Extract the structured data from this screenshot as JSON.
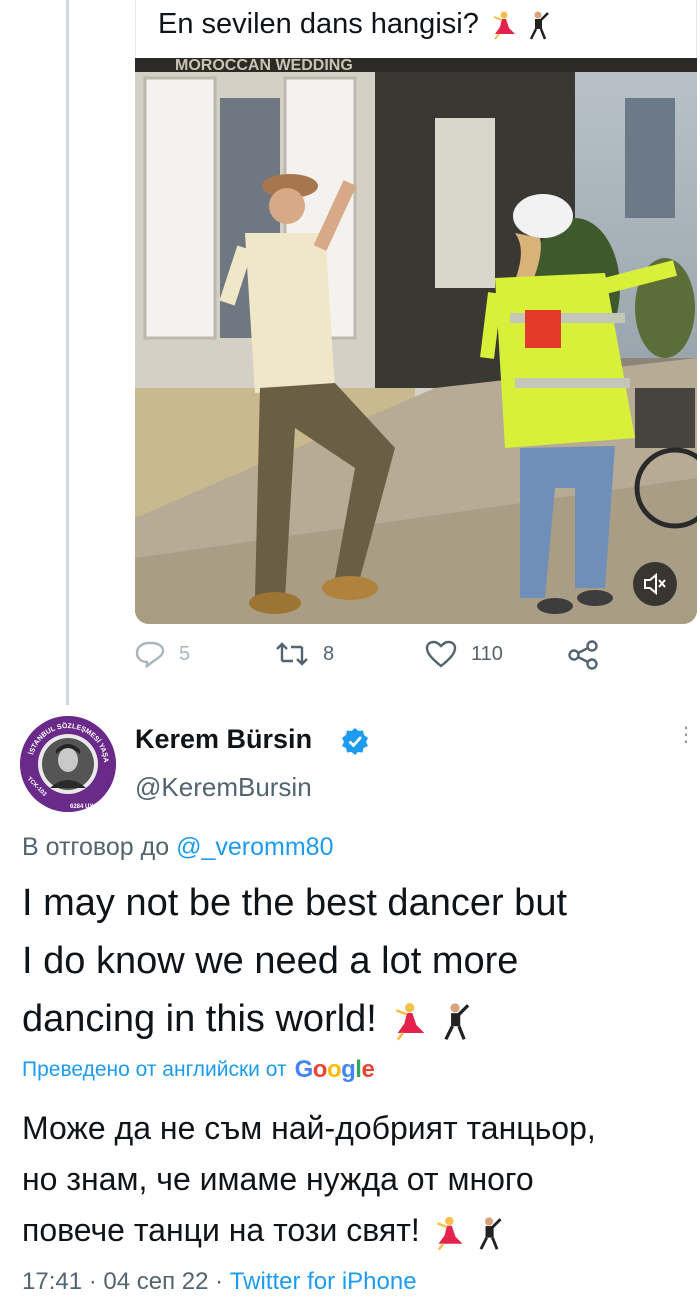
{
  "quoted": {
    "caption": "En sevilen dans hangisi?",
    "video_overlay_text": "MOROCCAN WEDDING",
    "mute_icon": "volume-mute-icon"
  },
  "actions": {
    "reply_count": "5",
    "retweet_count": "8",
    "like_count": "110"
  },
  "author": {
    "name": "Kerem Bürsin",
    "handle": "@KeremBursin",
    "avatar_ring_text_top": "İSTANBUL SÖZLEŞMESİ YAŞATIR",
    "avatar_ring_text_left": "TCK-103",
    "avatar_ring_text_right": "6284 UYGULA"
  },
  "reply": {
    "prefix": "В отговор до",
    "mention": "@_veromm80"
  },
  "tweet": {
    "line1": "I may not be the best dancer but",
    "line2": "I do know we need a lot more",
    "line3": "dancing in this world!"
  },
  "translation": {
    "label": "Преведено от английски от",
    "provider": "Google",
    "line1": "Може да не съм най-добрият танцьор,",
    "line2": "но знам, че имаме нужда от много",
    "line3": "повече танци на този свят!"
  },
  "meta": {
    "time": "17:41",
    "date": "04 сеп 22",
    "separator": " · ",
    "source": "Twitter for iPhone"
  },
  "colors": {
    "accent": "#1d9bf0",
    "muted": "#536471",
    "text": "#0f1419",
    "avatar_ring": "#6a2a8a"
  }
}
